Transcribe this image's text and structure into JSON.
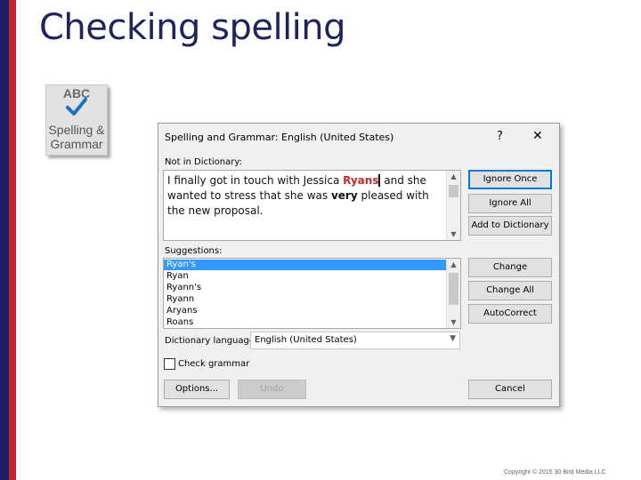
{
  "slide": {
    "title": "Checking spelling",
    "copyright": "Copyright © 2015 30 Bird Media LLC"
  },
  "ribbon_button": {
    "icon_text": "ABC",
    "label_line1": "Spelling &",
    "label_line2": "Grammar",
    "check_color": "#1e73be"
  },
  "dialog": {
    "title": "Spelling and Grammar: English (United States)",
    "help": "?",
    "close": "✕",
    "not_in_dictionary_label": "Not in Dictionary:",
    "sentence": {
      "part1": "I finally got in touch with Jessica ",
      "error_word": "Ryans",
      "part2": " and she wanted to stress that she was ",
      "bold_word": "very",
      "part3": " pleased with the new proposal."
    },
    "suggestions_label": "Suggestions:",
    "suggestions": [
      "Ryan's",
      "Ryan",
      "Ryann's",
      "Ryann",
      "Aryans",
      "Roans"
    ],
    "selected_suggestion_index": 0,
    "dictionary_language_label": "Dictionary language:",
    "dictionary_language_value": "English (United States)",
    "check_grammar_label": "Check grammar",
    "check_grammar_checked": false,
    "buttons": {
      "ignore_once": "Ignore Once",
      "ignore_all": "Ignore All",
      "add_to_dictionary": "Add to Dictionary",
      "change": "Change",
      "change_all": "Change All",
      "autocorrect": "AutoCorrect",
      "options": "Options...",
      "undo": "Undo",
      "cancel": "Cancel"
    }
  },
  "colors": {
    "title_color": "#1f2461",
    "stripe_blue": "#1d1e63",
    "stripe_red": "#c1272d",
    "error_word": "#c62828",
    "selection": "#3399ff"
  }
}
